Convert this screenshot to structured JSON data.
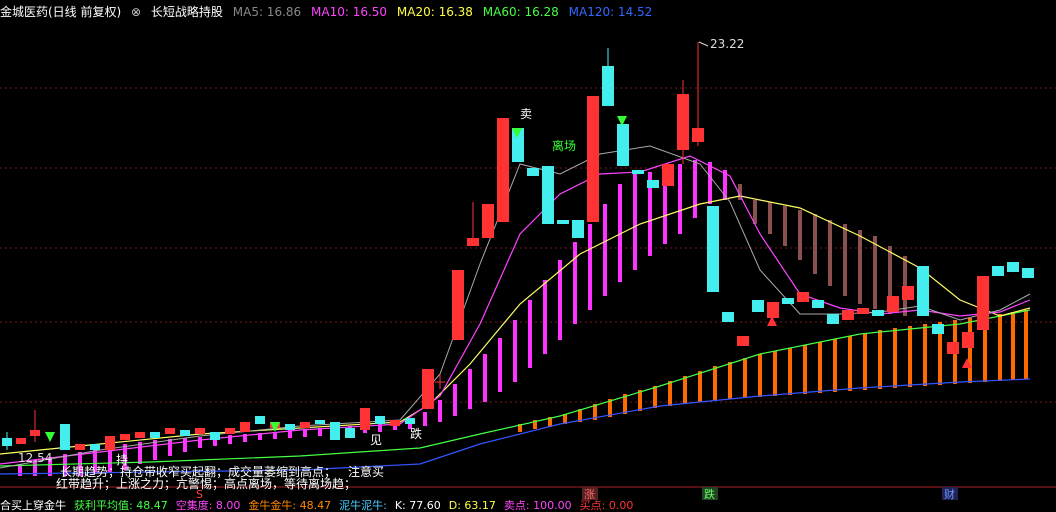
{
  "header": {
    "stock": "金城医药(日线 前复权)",
    "indicator_name": "长短战略持股",
    "ma5_label": "MA5: 16.86",
    "ma10_label": "MA10: 16.50",
    "ma20_label": "MA20: 16.38",
    "ma60_label": "MA60: 16.28",
    "ma120_label": "MA120: 14.52",
    "colors": {
      "ma5": "#888888",
      "ma10": "#ff44ff",
      "ma20": "#ffff44",
      "ma60": "#44ff44",
      "ma120": "#3366ff"
    }
  },
  "annotations": {
    "high": "23.22",
    "low": "12.54",
    "sell": "卖",
    "exit": "离场",
    "hold": "持",
    "see": "见",
    "drop": "跌",
    "note": "注意买"
  },
  "legend": {
    "line1": "长期趋势；持仓带收窄买起翻；成交量萎缩到高点；",
    "line2": "红带趋升；上涨之力；亢警惕；高点离场，等待离场趋；"
  },
  "markers": {
    "s": "S",
    "zhang": "涨",
    "die": "跌",
    "cai": "财"
  },
  "footer": {
    "items": [
      {
        "text": "合买上穿金牛",
        "color": "#ffffff"
      },
      {
        "text": "获利平均值: 48.47",
        "color": "#44ff44"
      },
      {
        "text": "空集度: 8.00",
        "color": "#ff44ff"
      },
      {
        "text": "金牛金牛: 48.47",
        "color": "#ff8800"
      },
      {
        "text": "泥牛泥牛:",
        "color": "#44ccff"
      },
      {
        "text": "K: 77.60",
        "color": "#ffffff"
      },
      {
        "text": "D: 63.17",
        "color": "#ffff44"
      },
      {
        "text": "卖点: 100.00",
        "color": "#ff44ff"
      },
      {
        "text": "买点: 0.00",
        "color": "#ff3333"
      }
    ]
  }
}
